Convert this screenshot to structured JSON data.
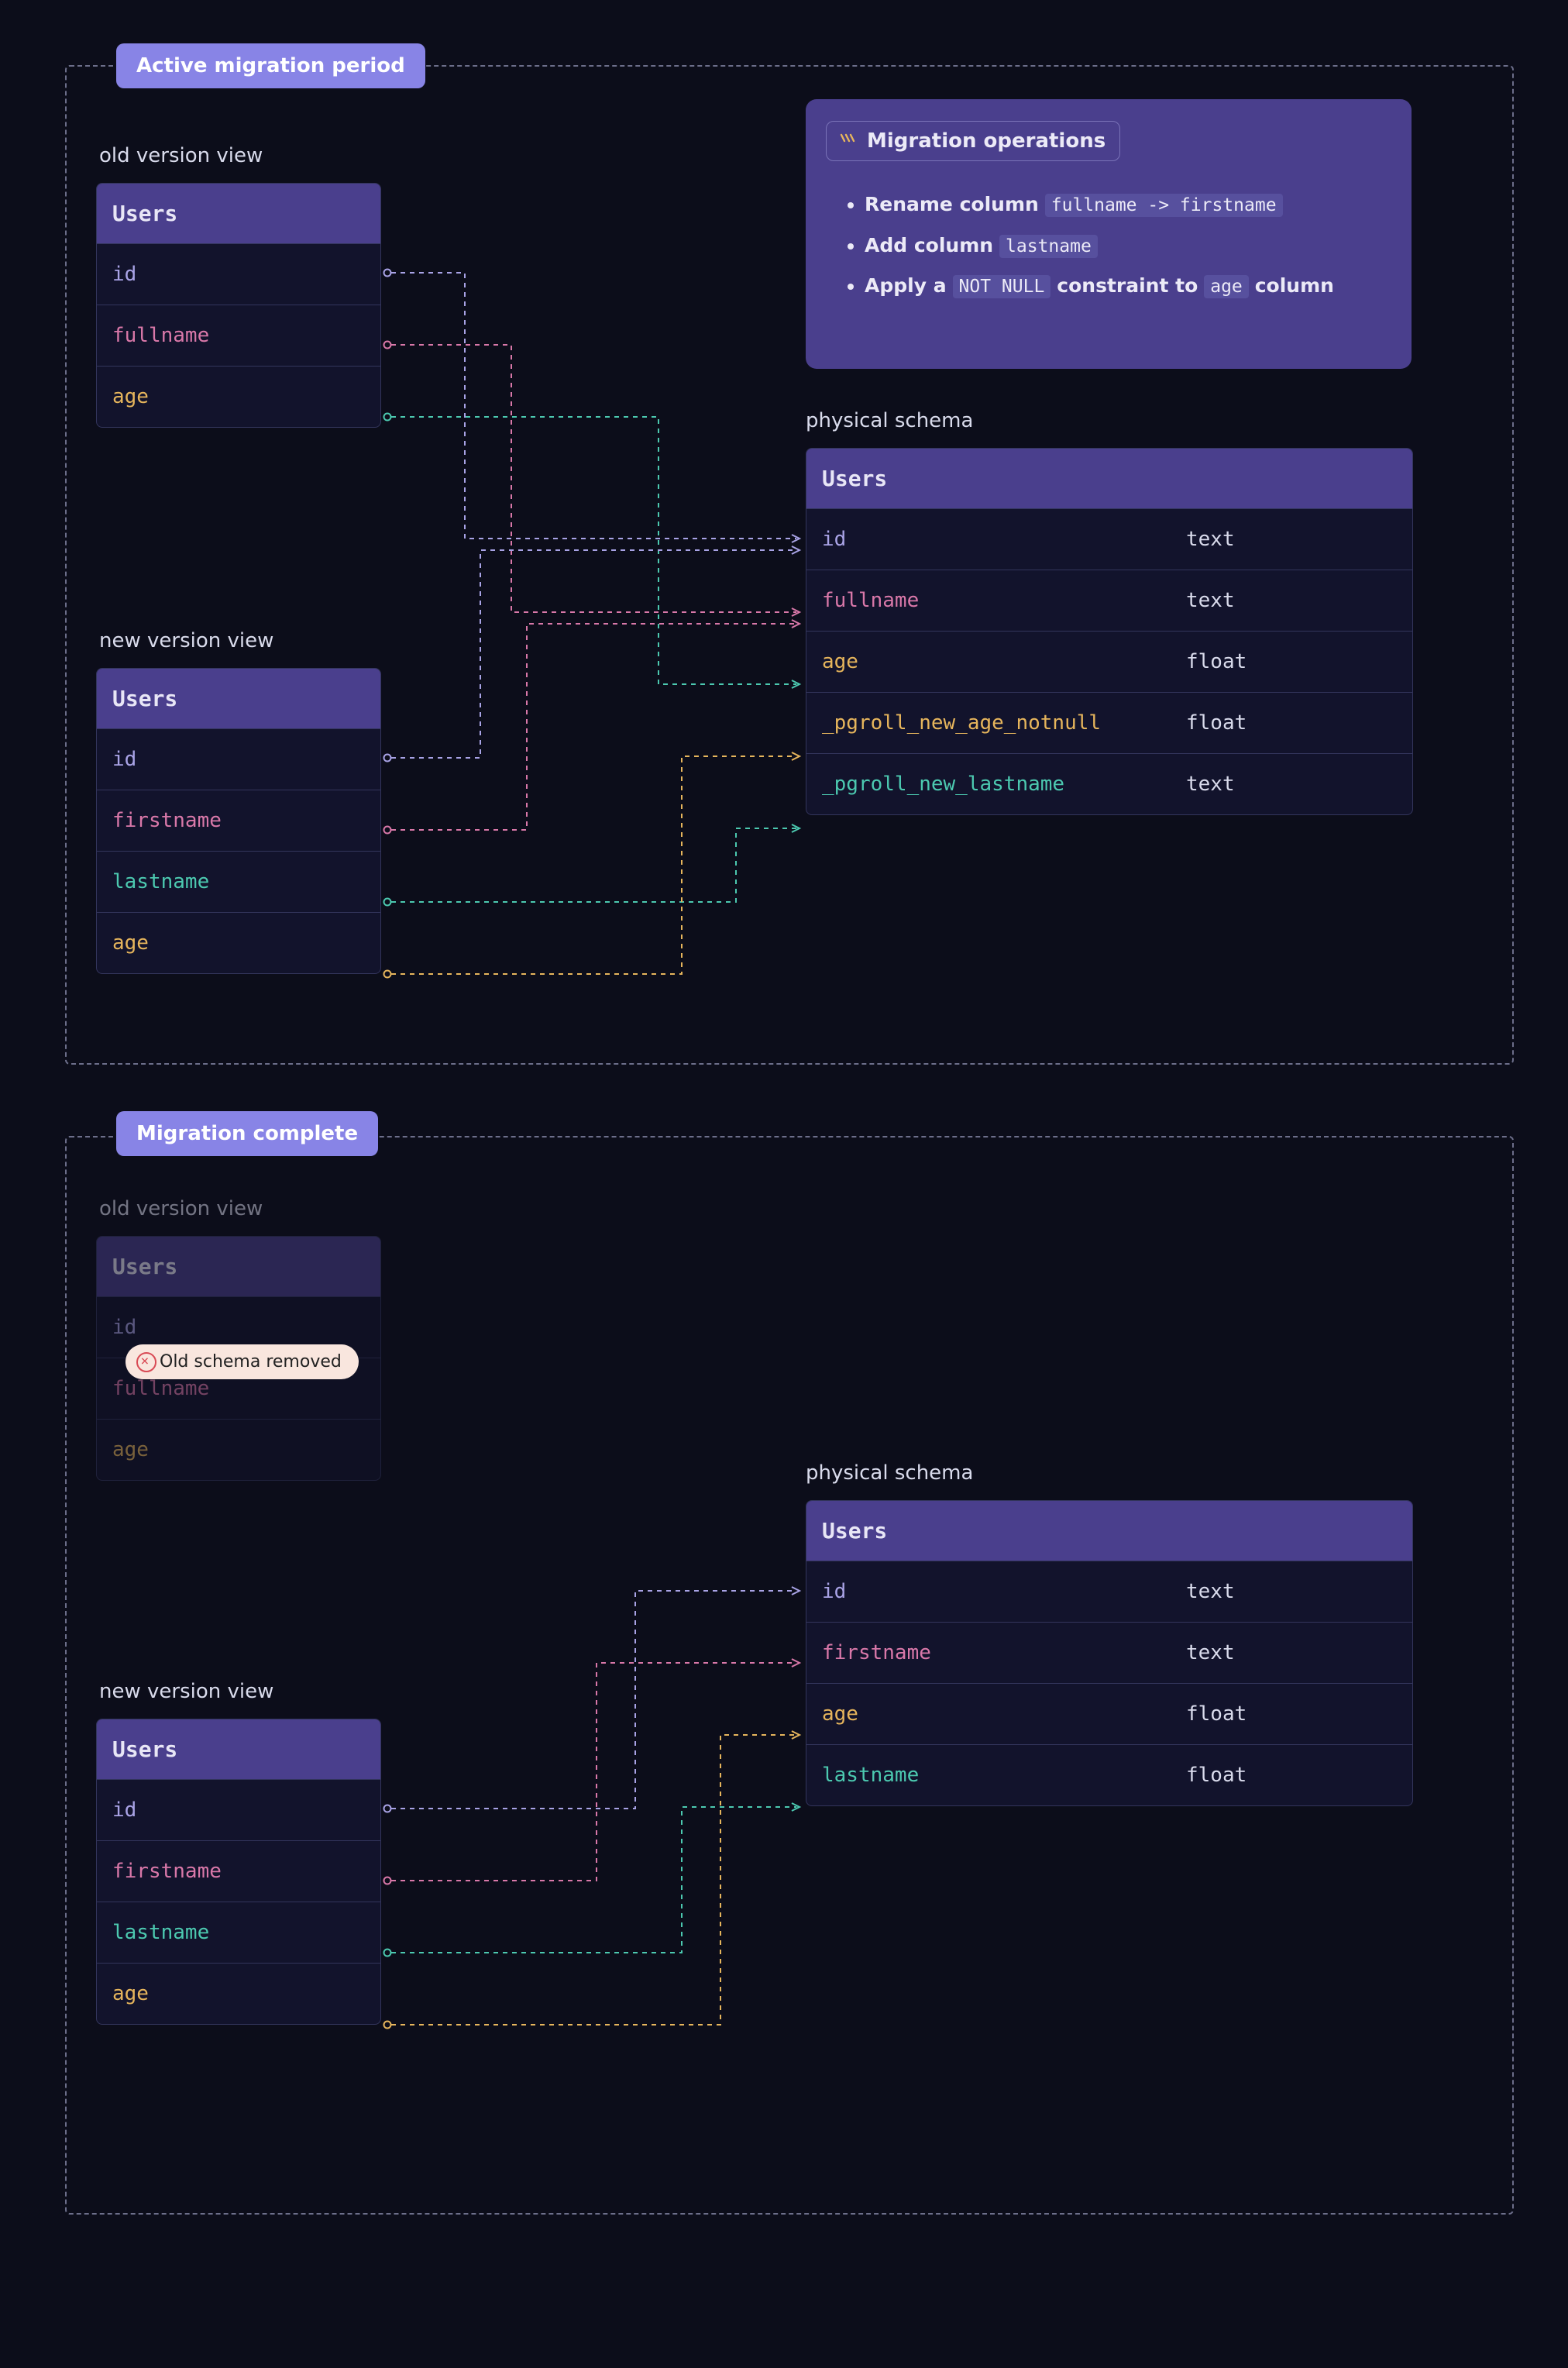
{
  "section1": {
    "badge": "Active migration period",
    "operations": {
      "title": "Migration operations",
      "items": [
        {
          "prefix": "Rename column",
          "code1": "fullname -> firstname",
          "mid": "",
          "code2": "",
          "suffix": ""
        },
        {
          "prefix": "Add column",
          "code1": "lastname",
          "mid": "",
          "code2": "",
          "suffix": ""
        },
        {
          "prefix": "Apply a",
          "code1": "NOT NULL",
          "mid": "constraint to",
          "code2": "age",
          "suffix": "column"
        }
      ]
    },
    "old_view": {
      "label": "old version view",
      "table": "Users",
      "cols": [
        {
          "name": "id",
          "cls": "c-id"
        },
        {
          "name": "fullname",
          "cls": "c-full"
        },
        {
          "name": "age",
          "cls": "c-age"
        }
      ]
    },
    "new_view": {
      "label": "new version view",
      "table": "Users",
      "cols": [
        {
          "name": "id",
          "cls": "c-id"
        },
        {
          "name": "firstname",
          "cls": "c-first"
        },
        {
          "name": "lastname",
          "cls": "c-last"
        },
        {
          "name": "age",
          "cls": "c-age"
        }
      ]
    },
    "physical": {
      "label": "physical schema",
      "table": "Users",
      "cols": [
        {
          "name": "id",
          "type": "text",
          "cls": "c-id"
        },
        {
          "name": "fullname",
          "type": "text",
          "cls": "c-full"
        },
        {
          "name": "age",
          "type": "float",
          "cls": "c-age"
        },
        {
          "name": "_pgroll_new_age_notnull",
          "type": "float",
          "cls": "c-newage"
        },
        {
          "name": "_pgroll_new_lastname",
          "type": "text",
          "cls": "c-newlast"
        }
      ]
    }
  },
  "section2": {
    "badge": "Migration complete",
    "pill": "Old schema removed",
    "old_view": {
      "label": "old version view",
      "table": "Users",
      "cols": [
        {
          "name": "id",
          "cls": "c-id"
        },
        {
          "name": "fullname",
          "cls": "c-full"
        },
        {
          "name": "age",
          "cls": "c-age"
        }
      ]
    },
    "new_view": {
      "label": "new version view",
      "table": "Users",
      "cols": [
        {
          "name": "id",
          "cls": "c-id"
        },
        {
          "name": "firstname",
          "cls": "c-first"
        },
        {
          "name": "lastname",
          "cls": "c-last"
        },
        {
          "name": "age",
          "cls": "c-age"
        }
      ]
    },
    "physical": {
      "label": "physical schema",
      "table": "Users",
      "cols": [
        {
          "name": "id",
          "type": "text",
          "cls": "c-id"
        },
        {
          "name": "firstname",
          "type": "text",
          "cls": "c-first"
        },
        {
          "name": "age",
          "type": "float",
          "cls": "c-newage"
        },
        {
          "name": "lastname",
          "type": "float",
          "cls": "c-newlast"
        }
      ]
    }
  },
  "colors": {
    "id": "#a9a3e6",
    "full": "#d978a9",
    "first": "#d978a9",
    "age": "#e6b55c",
    "last": "#4cc9b0"
  }
}
